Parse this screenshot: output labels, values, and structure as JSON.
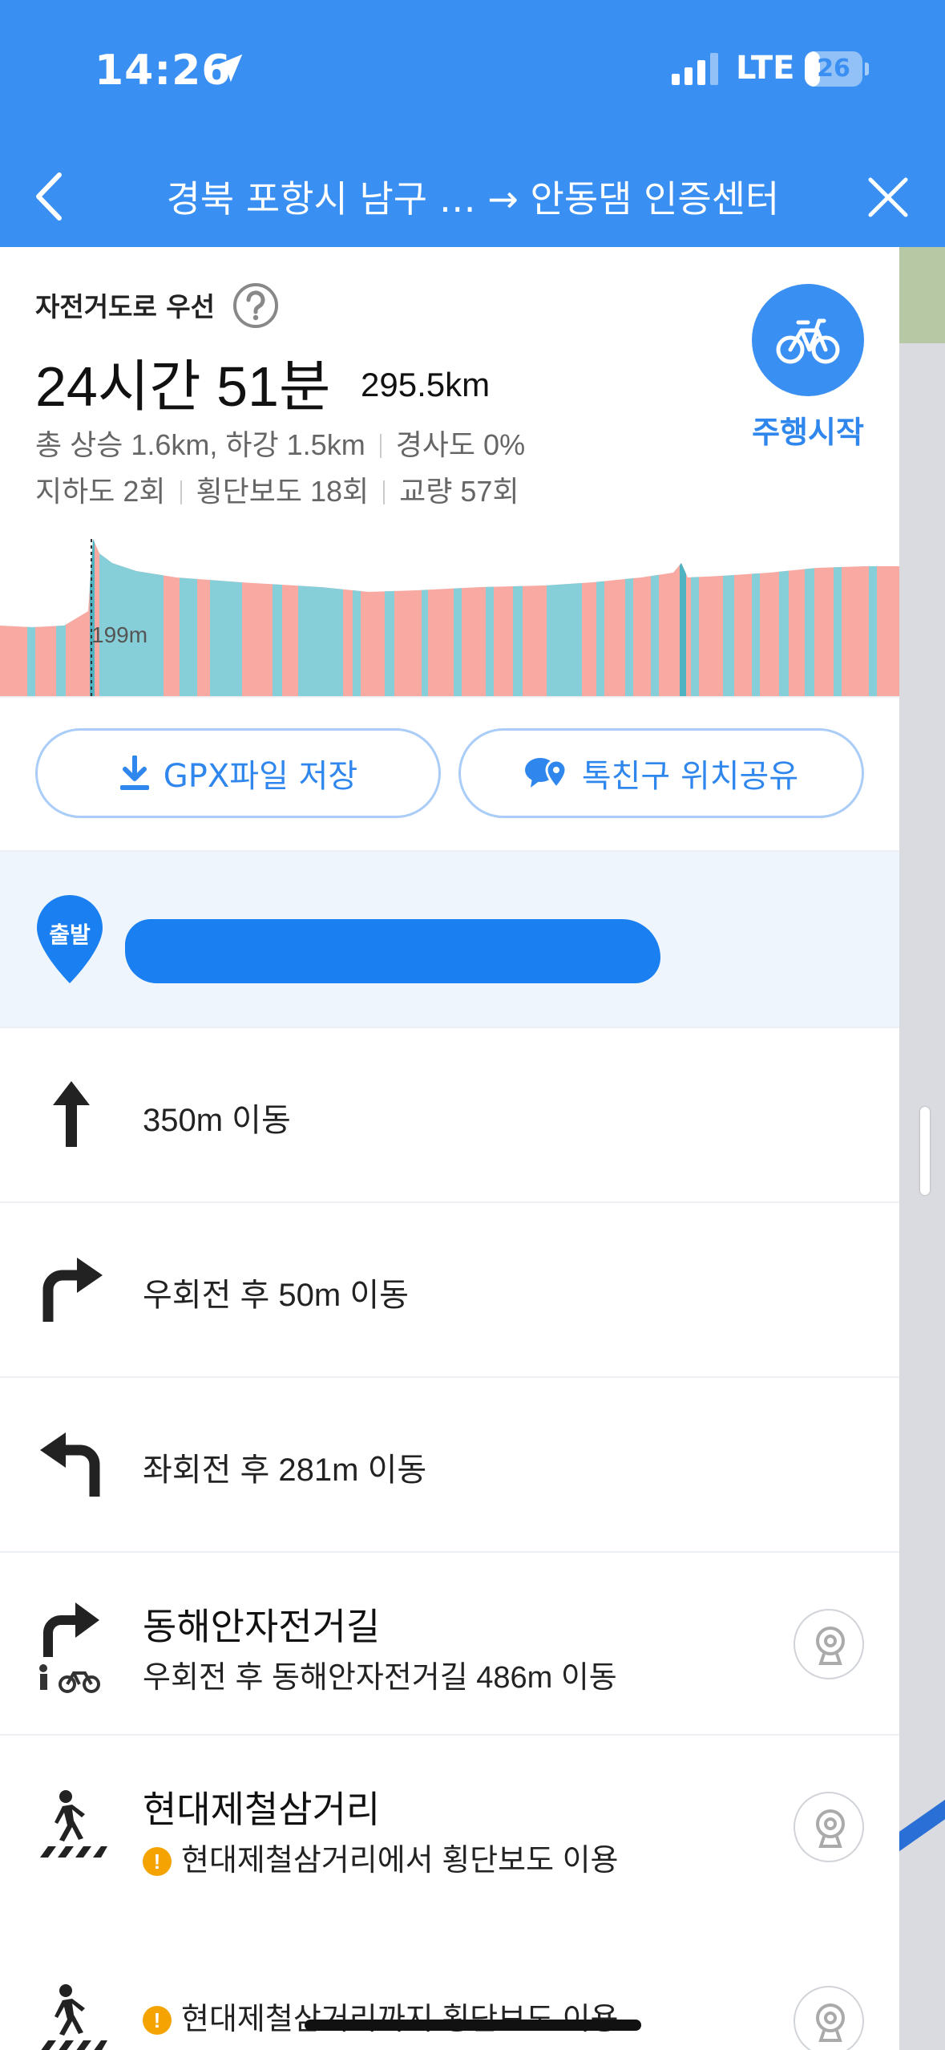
{
  "status_bar": {
    "time": "14:26",
    "network": "LTE",
    "battery": "26",
    "battery_level_percent": 26
  },
  "header": {
    "title": "경북 포항시 남구 … → 안동댐 인증센터",
    "back_icon": "chevron-left-icon",
    "close_icon": "close-icon",
    "background_color": "#3a8ff2"
  },
  "summary": {
    "route_preference": "자전거도로 우선",
    "duration": "24시간 51분",
    "distance": "295.5km",
    "ascent_descent": "총 상승 1.6km, 하강 1.5km",
    "slope": "경사도 0%",
    "underpass": "지하도 2회",
    "crosswalk": "횡단보도 18회",
    "bridge": "교량 57회",
    "start_button_label": "주행시작",
    "start_button_icon": "bicycle-icon",
    "accent_color": "#2f87ee"
  },
  "elevation": {
    "marker_label": "199m",
    "colors": {
      "road": "#f7a9a2",
      "bike_path": "#86cfd8"
    }
  },
  "actions": {
    "gpx_label": "GPX파일 저장",
    "gpx_icon": "download-icon",
    "share_label": "톡친구 위치공유",
    "share_icon": "talk-location-icon"
  },
  "start_point": {
    "badge": "출발"
  },
  "steps": [
    {
      "icon": "straight-arrow-icon",
      "text": "350m 이동"
    },
    {
      "icon": "turn-right-icon",
      "text": "우회전 후 50m 이동"
    },
    {
      "icon": "turn-left-icon",
      "text": "좌회전 후 281m 이동"
    },
    {
      "icon": "turn-right-bike-icon",
      "title": "동해안자전거길",
      "sub": "우회전 후 동해안자전거길 486m 이동",
      "action_icon": "cctv-icon"
    },
    {
      "icon": "crosswalk-icon",
      "title": "현대제철삼거리",
      "sub": "현대제철삼거리에서 횡단보도 이용",
      "warning_icon": "warning-icon",
      "action_icon": "cctv-icon"
    },
    {
      "icon": "crosswalk-icon",
      "sub": "현대제철삼거리까지 횡단보도 이용",
      "warning_icon": "warning-icon",
      "action_icon": "cctv-icon"
    }
  ]
}
